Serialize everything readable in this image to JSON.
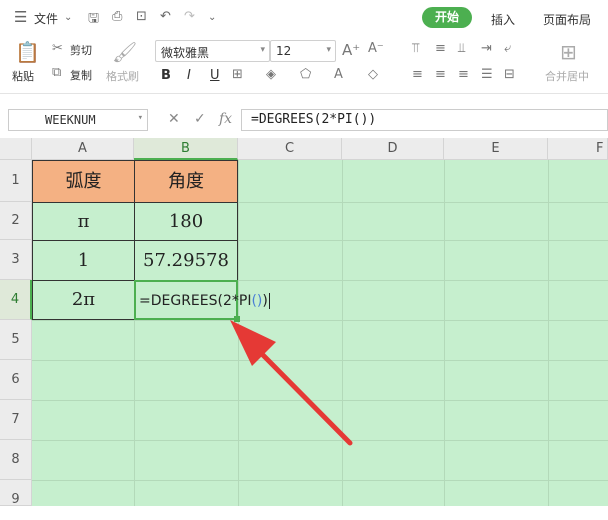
{
  "menu": {
    "menu_icon": "hamburger-icon",
    "file": "文件"
  },
  "tabs": {
    "home": "开始",
    "insert": "插入",
    "layout": "页面布局"
  },
  "ribbon": {
    "paste": "粘贴",
    "cut": "剪切",
    "copy": "复制",
    "format_painter": "格式刷",
    "font_name": "微软雅黑",
    "font_size": "12",
    "bold": "B",
    "italic": "I",
    "underline": "U",
    "merge_center": "合并居中"
  },
  "formula_bar": {
    "name_box": "WEEKNUM",
    "fx": "fx",
    "formula": "=DEGREES(2*PI())"
  },
  "columns": [
    "A",
    "B",
    "C",
    "D",
    "E",
    "F"
  ],
  "rows": [
    "1",
    "2",
    "3",
    "4",
    "5",
    "6",
    "7",
    "8",
    "9"
  ],
  "cells": {
    "a1": "弧度",
    "b1": "角度",
    "a2": "π",
    "b2": "180",
    "a3": "1",
    "b3": "57.29578",
    "a4": "2π",
    "b4_prefix": "=DEGREES(2*PI",
    "b4_parens": "()",
    "b4_suffix": ")"
  },
  "colors": {
    "header_fill": "#f4b183",
    "sheet_bg": "#c6efce",
    "accent": "#4caf50",
    "arrow": "#e53935"
  }
}
